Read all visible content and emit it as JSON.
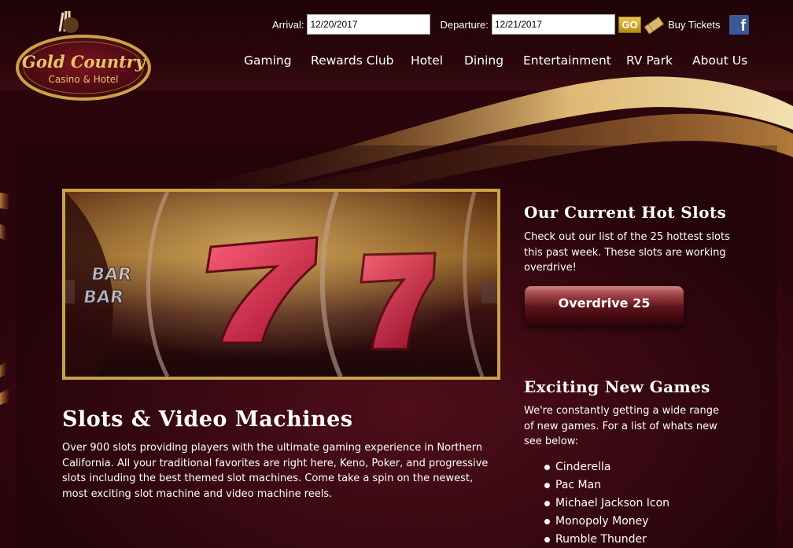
{
  "logo": {
    "text_main": "Gold Country",
    "text_sub": "Casino & Hotel"
  },
  "booking": {
    "arrival_label": "Arrival:",
    "arrival_value": "12/20/2017",
    "departure_label": "Departure:",
    "departure_value": "12/21/2017",
    "go_label": "GO",
    "buy_tickets_label": "Buy Tickets"
  },
  "nav": {
    "items": [
      {
        "label": "Gaming"
      },
      {
        "label": "Rewards Club"
      },
      {
        "label": "Hotel"
      },
      {
        "label": "Dining"
      },
      {
        "label": "Entertainment"
      },
      {
        "label": "RV Park"
      },
      {
        "label": "About Us"
      }
    ]
  },
  "hero": {
    "reel_text_1": "BAR",
    "reel_text_2": "BAR"
  },
  "main": {
    "title": "Slots & Video Machines",
    "body": "Over 900 slots providing players with the ultimate gaming experience in Northern California.  All your traditional favorites are right here, Keno, Poker, and progressive slots including the best themed slot machines. Come take a spin on the newest, most exciting slot machine and video machine reels."
  },
  "sidebar": {
    "hot_slots_title": "Our Current Hot Slots",
    "hot_slots_body": "Check out our list of the 25 hottest slots this past week. These slots are working overdrive!",
    "overdrive_button": "Overdrive 25",
    "new_games_title": "Exciting New Games",
    "new_games_body": "We're constantly getting a wide range of new games.  For a list of whats new see below:",
    "games": [
      "Cinderella",
      "Pac Man",
      "Michael Jackson Icon",
      "Monopoly Money",
      "Rumble Thunder"
    ]
  },
  "colors": {
    "gold_border": "#c9a24a",
    "background": "#4a0b18",
    "facebook": "#3b5998"
  }
}
